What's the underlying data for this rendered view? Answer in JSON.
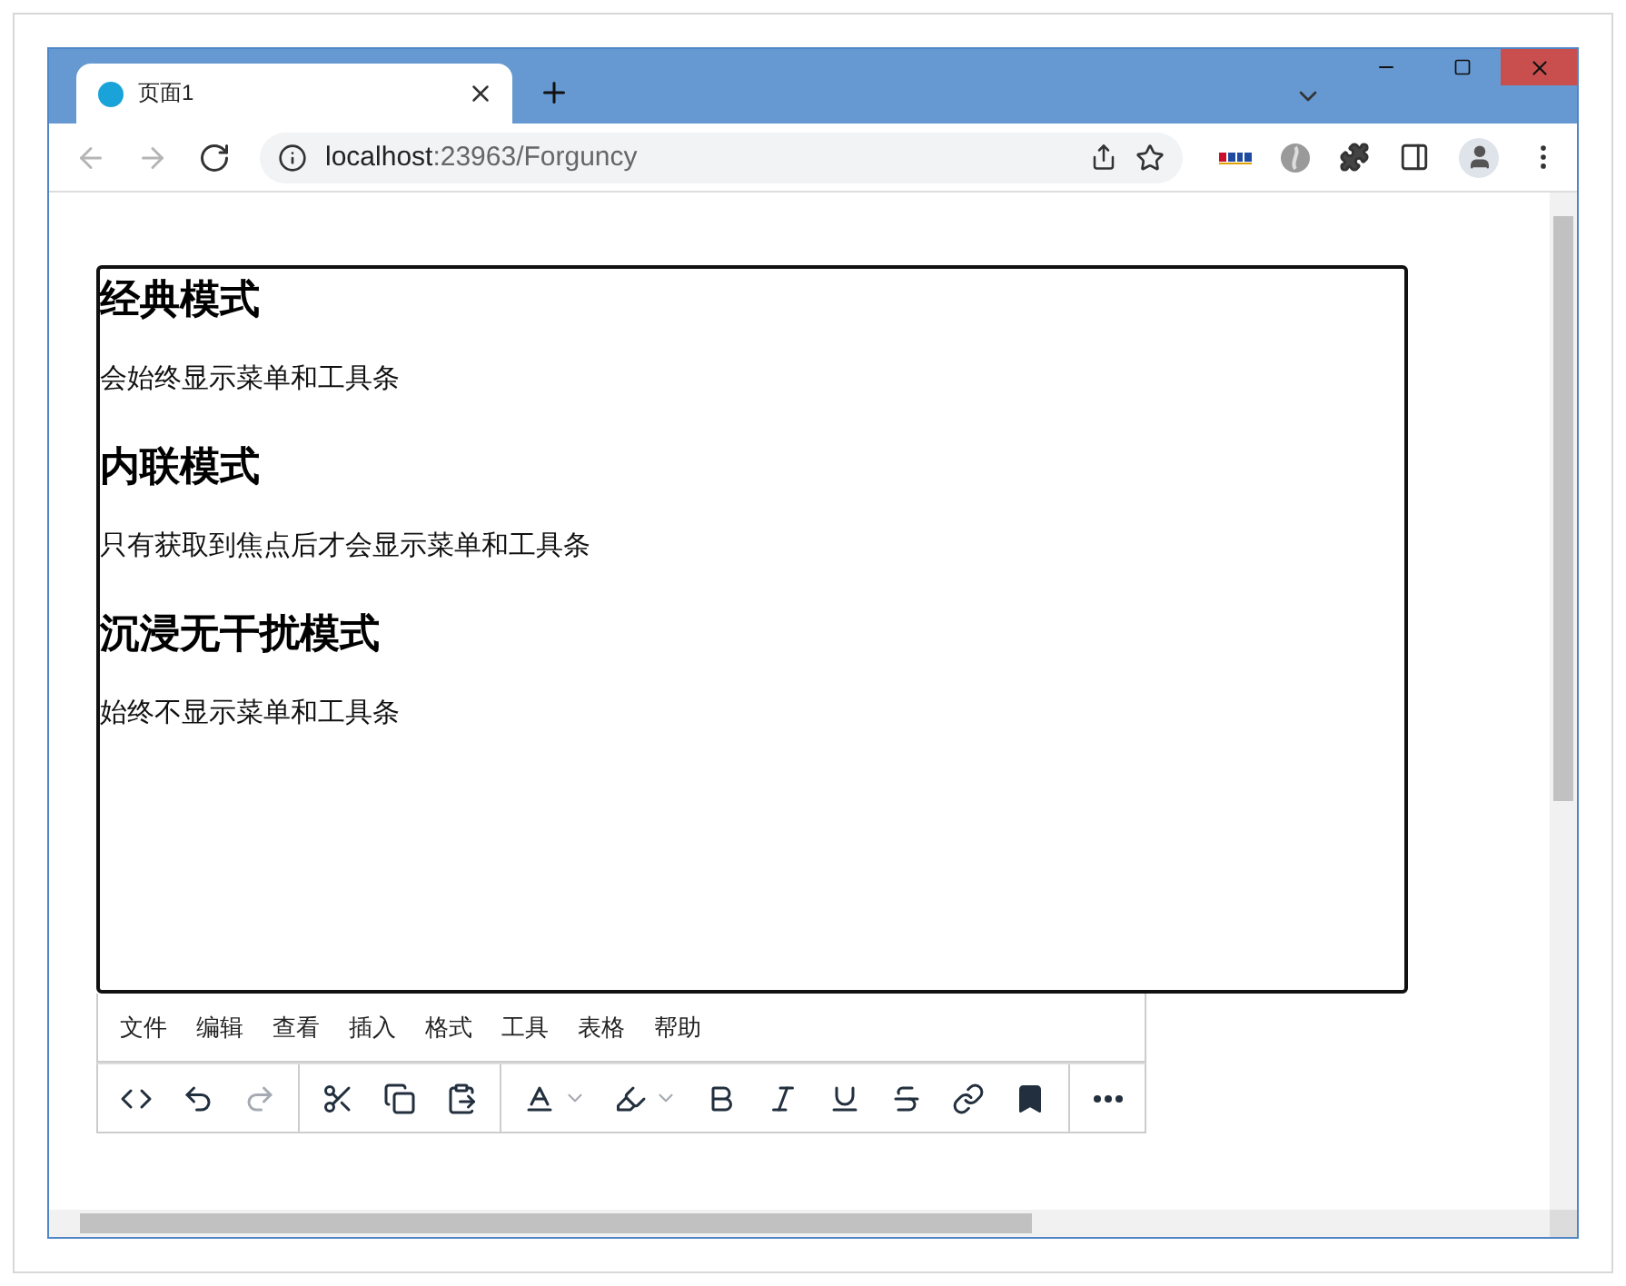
{
  "browser": {
    "tabs": [
      {
        "title": "页面1",
        "selected": true
      }
    ],
    "nav": [
      {
        "kind": "back",
        "disabled": true
      },
      {
        "kind": "forward",
        "disabled": true
      },
      {
        "kind": "reload",
        "disabled": false
      }
    ],
    "url": {
      "host": "localhost",
      "rest": ":23963/Forguncy"
    }
  },
  "editor": {
    "content": [
      {
        "kind": "heading",
        "text": "经典模式"
      },
      {
        "kind": "paragraph",
        "text": "会始终显示菜单和工具条"
      },
      {
        "kind": "heading",
        "text": "内联模式"
      },
      {
        "kind": "paragraph",
        "text": "只有获取到焦点后才会显示菜单和工具条"
      },
      {
        "kind": "heading",
        "text": "沉浸无干扰模式"
      },
      {
        "kind": "paragraph",
        "text": "始终不显示菜单和工具条"
      }
    ],
    "menubar": [
      "文件",
      "编辑",
      "查看",
      "插入",
      "格式",
      "工具",
      "表格",
      "帮助"
    ],
    "toolbar_groups": [
      [
        {
          "kind": "code",
          "disabled": false
        },
        {
          "kind": "undo",
          "disabled": false
        },
        {
          "kind": "redo",
          "disabled": true
        }
      ],
      [
        {
          "kind": "cut",
          "disabled": false
        },
        {
          "kind": "copy",
          "disabled": false
        },
        {
          "kind": "paste",
          "disabled": false
        }
      ],
      [
        {
          "kind": "text-color",
          "disabled": false
        },
        {
          "kind": "highlight",
          "disabled": false
        },
        {
          "kind": "bold",
          "disabled": false
        },
        {
          "kind": "italic",
          "disabled": false
        },
        {
          "kind": "underline",
          "disabled": false
        },
        {
          "kind": "strikethrough",
          "disabled": false
        },
        {
          "kind": "link",
          "disabled": false
        },
        {
          "kind": "bookmark",
          "disabled": false
        }
      ],
      [
        {
          "kind": "more",
          "disabled": false
        }
      ]
    ]
  }
}
